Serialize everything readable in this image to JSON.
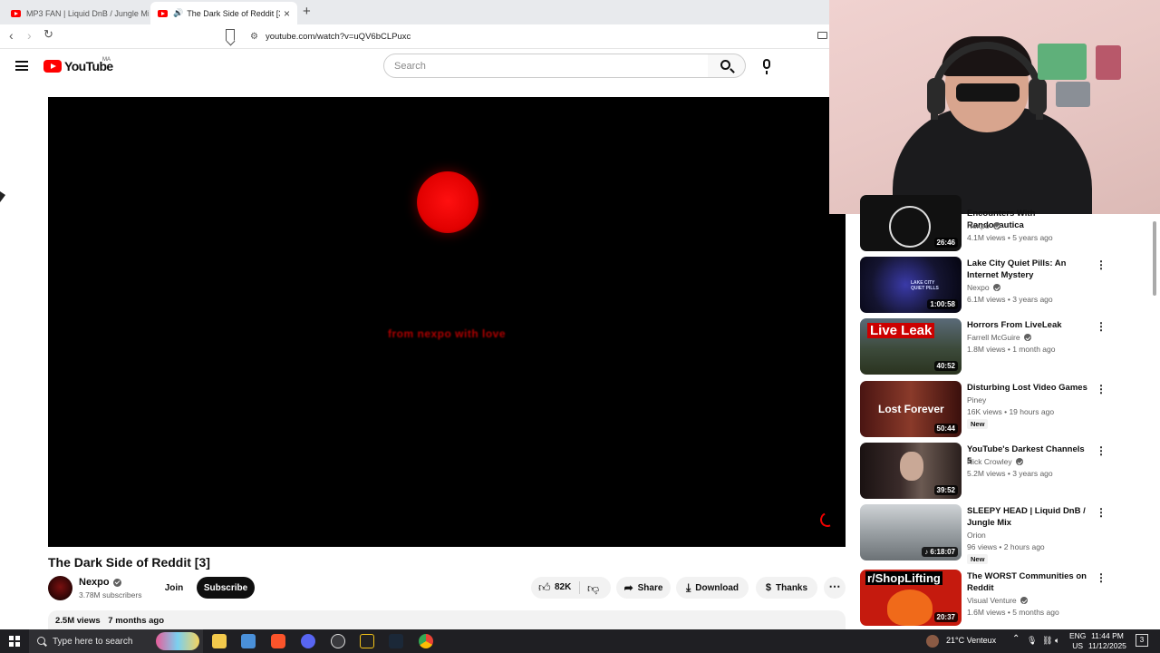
{
  "browser": {
    "tabs": [
      {
        "title": "MP3 FAN | Liquid DnB / Jungle Mix",
        "active": false
      },
      {
        "title": "The Dark Side of Reddit [3] -",
        "active": true
      }
    ],
    "new_tab": "+",
    "close": "×",
    "url": "youtube.com/watch?v=uQV6bCLPuxc"
  },
  "masthead": {
    "logo_text": "YouTube",
    "country_code": "MA",
    "search_placeholder": "Search"
  },
  "player": {
    "caption": "from nexpo with love"
  },
  "video": {
    "title": "The Dark Side of Reddit [3]",
    "channel": "Nexpo",
    "subscribers": "3.78M subscribers",
    "join_label": "Join",
    "subscribe_label": "Subscribe",
    "likes": "82K",
    "share_label": "Share",
    "download_label": "Download",
    "thanks_label": "Thanks",
    "views": "2.5M views",
    "age": "7 months ago"
  },
  "recommendations": [
    {
      "title": "Encounters With Randonautica",
      "channel": "Nexpo",
      "verified": true,
      "meta": "4.1M views • 5 years ago",
      "duration": "26:46",
      "badge": ""
    },
    {
      "title": "Lake City Quiet Pills: An Internet Mystery",
      "channel": "Nexpo",
      "verified": true,
      "meta": "6.1M views • 3 years ago",
      "duration": "1:00:58",
      "badge": ""
    },
    {
      "title": "Horrors From LiveLeak",
      "channel": "Farrell McGuire",
      "verified": true,
      "meta": "1.8M views • 1 month ago",
      "duration": "40:52",
      "badge": ""
    },
    {
      "title": "Disturbing Lost Video Games",
      "channel": "Piney",
      "verified": false,
      "meta": "16K views • 19 hours ago",
      "duration": "50:44",
      "badge": "New"
    },
    {
      "title": "YouTube's Darkest Channels 5",
      "channel": "Nick Crowley",
      "verified": true,
      "meta": "5.2M views • 3 years ago",
      "duration": "39:52",
      "badge": ""
    },
    {
      "title": "SLEEPY HEAD | Liquid DnB / Jungle Mix",
      "channel": "Orion",
      "verified": false,
      "meta": "96 views • 2 hours ago",
      "duration": "♪ 6:18:07",
      "badge": "New"
    },
    {
      "title": "The WORST Communities on Reddit",
      "channel": "Visual Venture",
      "verified": true,
      "meta": "1.6M views • 5 months ago",
      "duration": "20:37",
      "badge": ""
    }
  ],
  "thumb_text": {
    "lake_city": "LAKE CITY QUIET PILLS",
    "liveleak": "Live Leak",
    "lost_forever": "Lost Forever",
    "shoplifting": "r/ShopLifting"
  },
  "taskbar": {
    "search_placeholder": "Type here to search",
    "weather": "21°C  Venteux",
    "lang_top": "ENG",
    "lang_bottom": "US",
    "time": "11:44 PM",
    "date": "11/12/2025",
    "notifications": "3"
  }
}
